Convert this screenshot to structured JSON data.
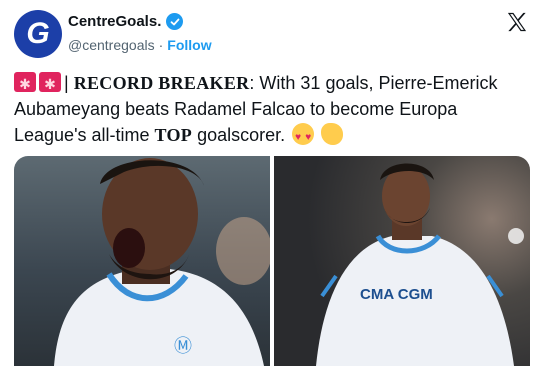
{
  "account": {
    "display_name": "CentreGoals.",
    "handle": "@centregoals",
    "separator": "·",
    "follow_label": "Follow",
    "avatar_letter": "G",
    "avatar_color": "#1c3fa8",
    "verified_icon": "verified-badge-icon",
    "verified_color": "#1d9bf0"
  },
  "platform_icon": "x-logo-icon",
  "tweet": {
    "emoji_prefix": [
      "police-light-icon",
      "police-light-icon"
    ],
    "pipe": "|",
    "headline": "RECORD BREAKER",
    "part1": ": With 31 goals, Pierre-Emerick Aubameyang beats Radamel Falcao to become Europa League's all-time ",
    "emphasis": "TOP",
    "part2": " goalscorer.",
    "emoji_suffix": [
      "heart-eyes-emoji",
      "clapping-hands-emoji"
    ]
  },
  "media": {
    "photo_count": 2,
    "photos": [
      {
        "name": "celebration-photo-left",
        "sponsor": ""
      },
      {
        "name": "celebration-photo-right",
        "sponsor": "CMA CGM"
      }
    ],
    "kit_color": "#eef1f6",
    "kit_accent": "#3a8fd6"
  }
}
